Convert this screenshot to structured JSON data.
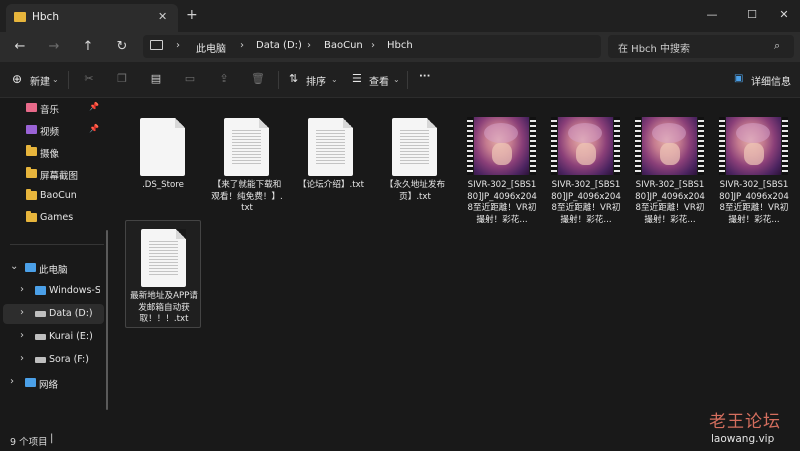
{
  "window": {
    "tab_title": "Hbch",
    "new_tab": "+",
    "controls": {
      "minimize": "—",
      "maximize": "☐",
      "close": "✕"
    }
  },
  "address": {
    "crumbs": [
      "此电脑",
      "Data (D:)",
      "BaoCun",
      "Hbch"
    ],
    "search_placeholder": "在 Hbch 中搜索"
  },
  "toolbar": {
    "new_label": "新建",
    "sort_label": "排序",
    "view_label": "查看",
    "more_label": "···",
    "details_label": "详细信息"
  },
  "sidebar": {
    "quick": [
      {
        "label": "音乐",
        "icon": "music-icon",
        "pinned": true
      },
      {
        "label": "视频",
        "icon": "video-icon",
        "pinned": true
      },
      {
        "label": "摄像",
        "icon": "folder-icon"
      },
      {
        "label": "屏幕截图",
        "icon": "folder-icon"
      },
      {
        "label": "BaoCun",
        "icon": "folder-icon"
      },
      {
        "label": "Games",
        "icon": "folder-icon"
      }
    ],
    "tree": [
      {
        "label": "此电脑",
        "icon": "computer-icon",
        "expanded": true
      },
      {
        "label": "Windows-SSD",
        "icon": "windows-drive-icon"
      },
      {
        "label": "Data (D:)",
        "icon": "drive-icon",
        "selected": true
      },
      {
        "label": "Kurai (E:)",
        "icon": "drive-icon"
      },
      {
        "label": "Sora (F:)",
        "icon": "drive-icon"
      },
      {
        "label": "网络",
        "icon": "network-icon"
      }
    ]
  },
  "files": [
    {
      "name": ".DS_Store",
      "type": "doc",
      "blank": true
    },
    {
      "name": "【来了就能下载和观看！纯免费！】.txt",
      "type": "doc"
    },
    {
      "name": "【论坛介绍】.txt",
      "type": "doc"
    },
    {
      "name": "【永久地址发布页】.txt",
      "type": "doc"
    },
    {
      "name": "SIVR-302_[SBS180]JP_4096x2048至近距離！VR初撮射！彩花...",
      "type": "video"
    },
    {
      "name": "SIVR-302_[SBS180]JP_4096x2048至近距離！VR初撮射！彩花...",
      "type": "video"
    },
    {
      "name": "SIVR-302_[SBS180]JP_4096x2048至近距離！VR初撮射！彩花...",
      "type": "video"
    },
    {
      "name": "SIVR-302_[SBS180]JP_4096x2048至近距離！VR初撮射！彩花...",
      "type": "video"
    },
    {
      "name": "最新地址及APP请发邮箱自动获取！！！.txt",
      "type": "doc",
      "selected": true
    }
  ],
  "status": {
    "count": "9 个项目"
  },
  "watermark": {
    "title": "老王论坛",
    "url": "laowang.vip"
  },
  "colors": {
    "folder": "#e7b53c",
    "accent": "#4ba0e8",
    "background": "#191919"
  }
}
